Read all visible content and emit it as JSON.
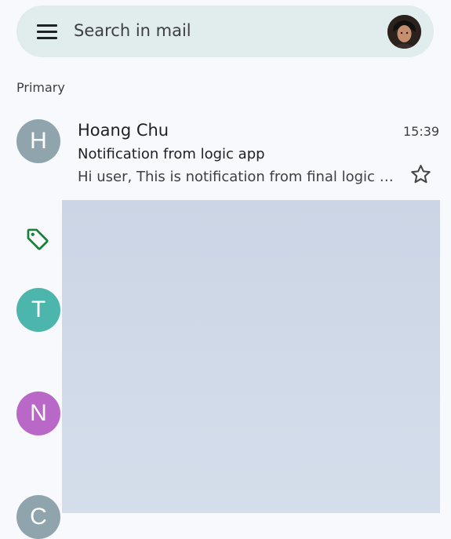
{
  "search": {
    "placeholder": "Search in mail",
    "menu_icon": "menu-icon",
    "avatar_icon": "account-avatar"
  },
  "mailbox": {
    "section": "Primary"
  },
  "emails": [
    {
      "sender": "Hoang Chu",
      "initial": "H",
      "avatar_color": "#90a4ae",
      "time": "15:39",
      "subject": "Notification from logic app",
      "snippet": "Hi user, This is notification from final logic a...",
      "starred": false
    }
  ],
  "partial_rows": [
    {
      "initial": "T",
      "avatar_color": "#4db6ac"
    },
    {
      "initial": "N",
      "avatar_color": "#ba68c8"
    },
    {
      "initial": "C",
      "avatar_color": "#90a4ae"
    }
  ],
  "icons": {
    "star": "star-outline-icon",
    "tag": "label-tag-icon"
  },
  "colors": {
    "search_bar": "#e1eced",
    "background": "#f7f9fc",
    "tag_green": "#188038",
    "overlay": "#cbd5e5"
  }
}
